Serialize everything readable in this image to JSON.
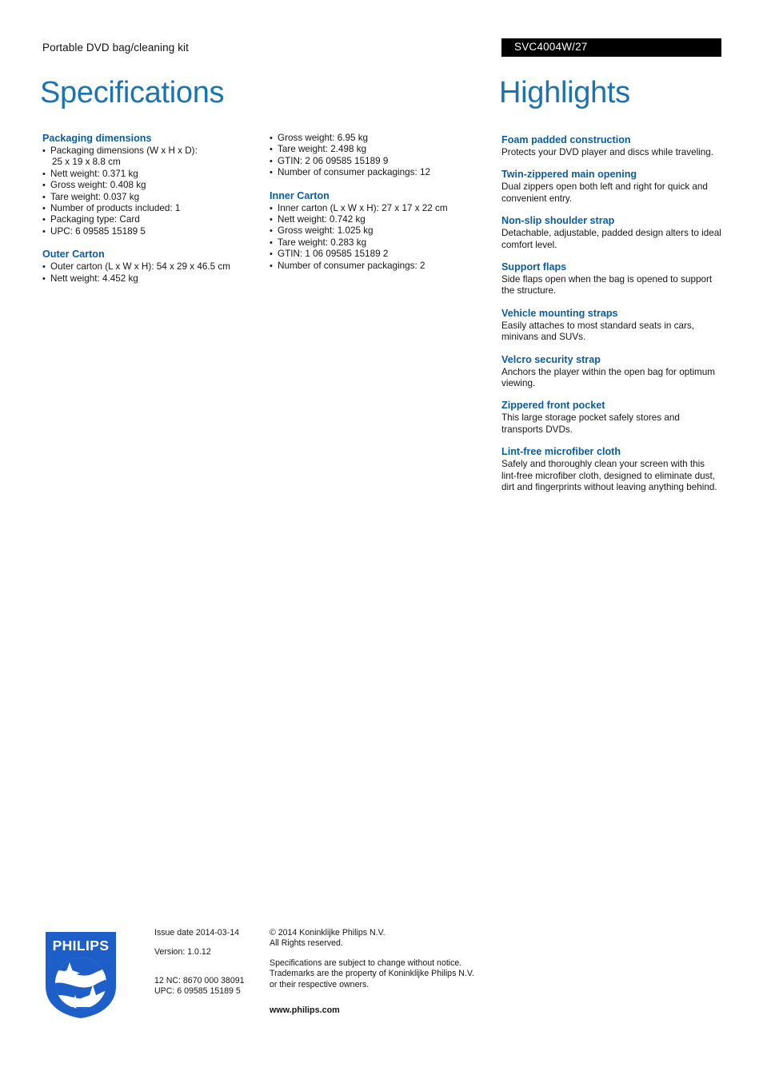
{
  "header": {
    "product_name": "Portable DVD bag/cleaning kit",
    "product_code": "SVC4004W/27"
  },
  "titles": {
    "specifications": "Specifications",
    "highlights": "Highlights"
  },
  "specifications": {
    "column_1": [
      {
        "heading": "Packaging dimensions",
        "items": [
          {
            "text": "Packaging dimensions (W x H x D):",
            "continuation": "25 x 19 x 8.8 cm"
          },
          {
            "text": "Nett weight: 0.371 kg"
          },
          {
            "text": "Gross weight: 0.408 kg"
          },
          {
            "text": "Tare weight: 0.037 kg"
          },
          {
            "text": "Number of products included: 1"
          },
          {
            "text": "Packaging type: Card"
          },
          {
            "text": "UPC: 6 09585 15189 5"
          }
        ]
      },
      {
        "heading": "Outer Carton",
        "items": [
          {
            "text": "Outer carton (L x W x H): 54 x 29 x 46.5 cm"
          },
          {
            "text": "Nett weight: 4.452 kg"
          }
        ]
      }
    ],
    "column_2": [
      {
        "heading": "",
        "items": [
          {
            "text": "Gross weight: 6.95 kg"
          },
          {
            "text": "Tare weight: 2.498 kg"
          },
          {
            "text": "GTIN: 2 06 09585 15189 9"
          },
          {
            "text": "Number of consumer packagings: 12"
          }
        ]
      },
      {
        "heading": "Inner Carton",
        "items": [
          {
            "text": "Inner carton (L x W x H): 27 x 17 x 22 cm"
          },
          {
            "text": "Nett weight: 0.742 kg"
          },
          {
            "text": "Gross weight: 1.025 kg"
          },
          {
            "text": "Tare weight: 0.283 kg"
          },
          {
            "text": "GTIN: 1 06 09585 15189 2"
          },
          {
            "text": "Number of consumer packagings: 2"
          }
        ]
      }
    ]
  },
  "highlights": [
    {
      "title": "Foam padded construction",
      "description": "Protects your DVD player and discs while traveling."
    },
    {
      "title": "Twin-zippered main opening",
      "description": "Dual zippers open both left and right for quick and convenient entry."
    },
    {
      "title": "Non-slip shoulder strap",
      "description": "Detachable, adjustable, padded design alters to ideal comfort level."
    },
    {
      "title": "Support flaps",
      "description": "Side flaps open when the bag is opened to support the structure."
    },
    {
      "title": "Vehicle mounting straps",
      "description": "Easily attaches to most standard seats in cars, minivans and SUVs."
    },
    {
      "title": "Velcro security strap",
      "description": "Anchors the player within the open bag for optimum viewing."
    },
    {
      "title": "Zippered front pocket",
      "description": "This large storage pocket safely stores and transports DVDs."
    },
    {
      "title": "Lint-free microfiber cloth",
      "description": "Safely and thoroughly clean your screen with this lint-free microfiber cloth, designed to eliminate dust, dirt and fingerprints without leaving anything behind."
    }
  ],
  "footer": {
    "logo_wordmark": "PHILIPS",
    "issue_date": "Issue date 2014-03-14",
    "version": "Version: 1.0.12",
    "twelve_nc": "12 NC: 8670 000 38091",
    "upc": "UPC: 6 09585 15189 5",
    "copyright_line_1": "© 2014 Koninklijke Philips N.V.",
    "copyright_line_2": "All Rights reserved.",
    "disclaimer_line_1": "Specifications are subject to change without notice.",
    "disclaimer_line_2": "Trademarks are the property of Koninklijke Philips N.V.",
    "disclaimer_line_3": "or their respective owners.",
    "website": "www.philips.com"
  },
  "colors": {
    "title_blue": "#1b73b0",
    "heading_blue": "#0b5c9e",
    "logo_blue": "#1d5ec9",
    "banner_black": "#000000",
    "body_text": "#161616"
  }
}
